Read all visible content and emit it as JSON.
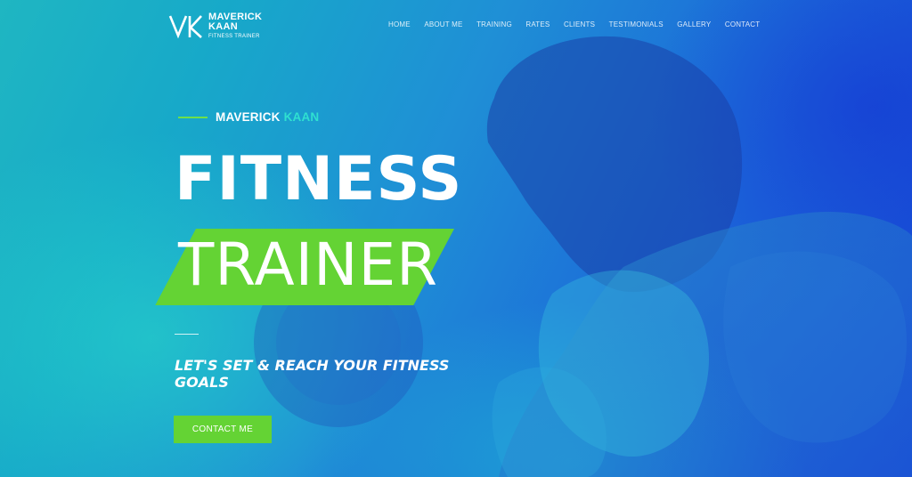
{
  "brand": {
    "monogram": "VK",
    "name": "MAVERICK KAAN",
    "name_line1": "MAVERICK",
    "name_line2": "KAAN",
    "subtitle": "FITNESS TRAINER"
  },
  "nav": {
    "items": [
      {
        "label": "HOME"
      },
      {
        "label": "ABOUT ME"
      },
      {
        "label": "TRAINING"
      },
      {
        "label": "RATES"
      },
      {
        "label": "CLIENTS"
      },
      {
        "label": "TESTIMONIALS"
      },
      {
        "label": "GALLERY"
      },
      {
        "label": "CONTACT"
      }
    ]
  },
  "hero": {
    "eyebrow_first": "MAVERICK",
    "eyebrow_accent": "KAAN",
    "title_line1": "FITNESS",
    "title_line2": "TRAINER",
    "tagline": "LET'S SET & REACH YOUR FITNESS GOALS",
    "cta_label": "CONTACT ME"
  },
  "colors": {
    "accent_green": "#64d334",
    "accent_teal": "#2fe0d0",
    "gradient_start": "#1fb6c2",
    "gradient_end": "#1646d6"
  },
  "icons": {
    "logo": "vk-monogram-icon",
    "hero_image": "athlete-with-dumbbell-photo"
  }
}
